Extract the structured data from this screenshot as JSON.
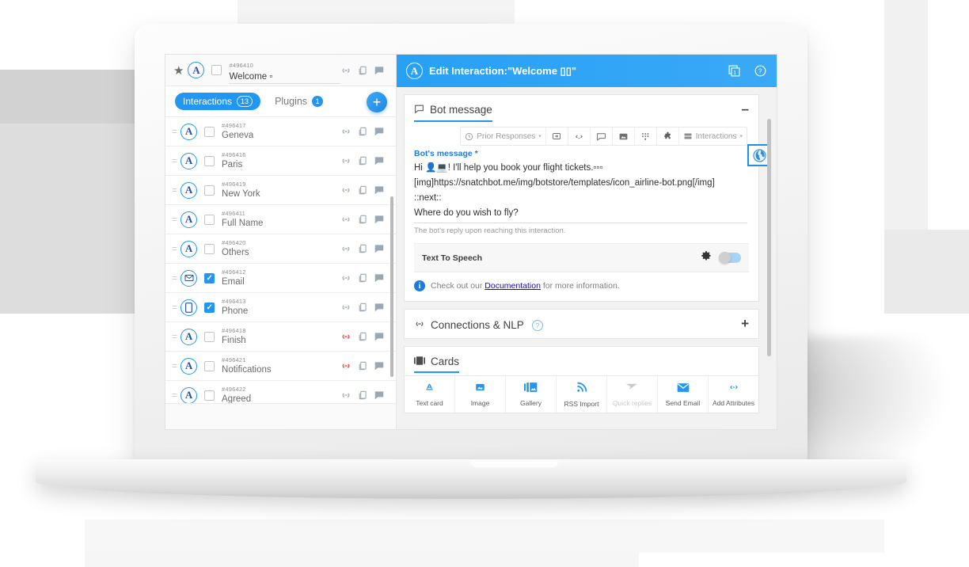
{
  "colors": {
    "accent": "#2196f3",
    "header_blue": "#27a0f5",
    "link": "#1a0dab",
    "danger": "#f0382f"
  },
  "sidebar": {
    "header": {
      "id": "#496410",
      "name": "Welcome ▫",
      "star_icon": "star-icon",
      "avatar": "A"
    },
    "tabs": {
      "interactions_label": "Interactions",
      "interactions_count": "13",
      "plugins_label": "Plugins",
      "plugins_count": "1",
      "add_label": "+"
    },
    "rows": [
      {
        "id": "#496417",
        "name": "Geneva",
        "icon": "A",
        "checked": false,
        "link_red": false
      },
      {
        "id": "#496416",
        "name": "Paris",
        "icon": "A",
        "checked": false,
        "link_red": false
      },
      {
        "id": "#496419",
        "name": "New York",
        "icon": "A",
        "checked": false,
        "link_red": false
      },
      {
        "id": "#496411",
        "name": "Full Name",
        "icon": "A",
        "checked": false,
        "link_red": false
      },
      {
        "id": "#496420",
        "name": "Others",
        "icon": "A",
        "checked": false,
        "link_red": false
      },
      {
        "id": "#496412",
        "name": "Email",
        "icon": "envelope-icon",
        "checked": true,
        "link_red": false
      },
      {
        "id": "#496413",
        "name": "Phone",
        "icon": "phone-icon",
        "checked": true,
        "link_red": false
      },
      {
        "id": "#496418",
        "name": "Finish",
        "icon": "A",
        "checked": false,
        "link_red": true
      },
      {
        "id": "#496421",
        "name": "Notifications",
        "icon": "A",
        "checked": false,
        "link_red": true
      },
      {
        "id": "#496422",
        "name": "Agreed",
        "icon": "A",
        "checked": false,
        "link_red": false
      }
    ],
    "row_actions": [
      "link-icon",
      "copy-icon",
      "comment-icon"
    ]
  },
  "main": {
    "header": {
      "avatar": "A",
      "title": "Edit Interaction:\"Welcome ▯▯\"",
      "window_icon": "window-1-icon",
      "help_icon": "help-icon"
    },
    "bot_message_card": {
      "title": "Bot message",
      "collapse_label": "–",
      "toolbar": {
        "prior_responses": "Prior Responses",
        "caret": "▾",
        "buttons": [
          "insert-variable-icon",
          "code-icon",
          "speech-bubble-icon",
          "image-icon",
          "keypad-icon",
          "puzzle-icon"
        ],
        "interactions_select": "Interactions"
      },
      "field_label": "Bot's message *",
      "lines": [
        "Hi 👤💻! I'll help you book your flight tickets.▫▫▫",
        "[img]https://snatchbot.me/img/botstore/templates/icon_airline-bot.png[/img]",
        "::next::",
        "Where do you wish to fly?"
      ],
      "hint": "The bot's reply upon reaching this interaction.",
      "translate_icon": "globe-icon",
      "tts_label": "Text To Speech",
      "tts_settings_icon": "gear-icon",
      "tts_toggle_on": false,
      "doc_prefix": "Check out our ",
      "doc_link": "Documentation",
      "doc_suffix": " for more information."
    },
    "connections_card": {
      "title": "Connections & NLP",
      "badge": "?",
      "expand_label": "+"
    },
    "cards_card": {
      "title": "Cards",
      "buttons": [
        {
          "label": "Text card",
          "icon": "text-card-icon",
          "disabled": false
        },
        {
          "label": "Image",
          "icon": "image-icon",
          "disabled": false
        },
        {
          "label": "Gallery",
          "icon": "gallery-icon",
          "disabled": false
        },
        {
          "label": "RSS Import",
          "icon": "rss-icon",
          "disabled": false
        },
        {
          "label": "Quick replies",
          "icon": "send-icon",
          "disabled": true
        },
        {
          "label": "Send Email",
          "icon": "envelope-icon",
          "disabled": false
        },
        {
          "label": "Add Attributes",
          "icon": "code-icon",
          "disabled": false
        }
      ]
    }
  }
}
